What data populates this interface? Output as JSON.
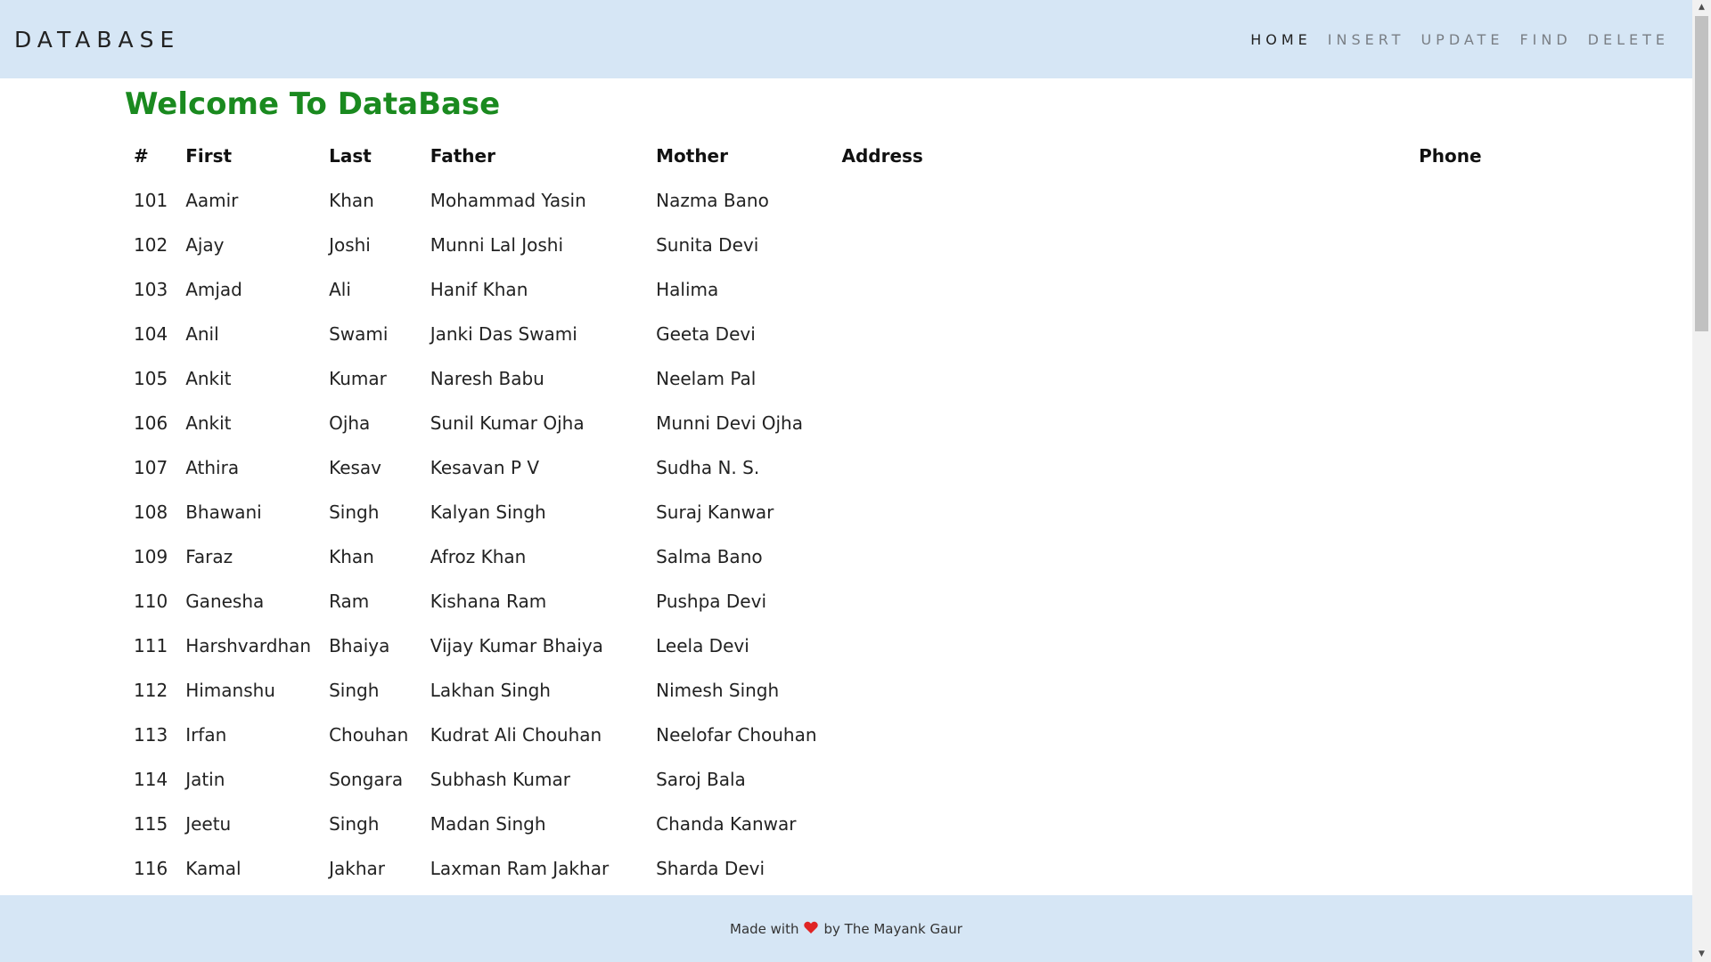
{
  "navbar": {
    "brand": "DATABASE",
    "links": [
      "HOME",
      "INSERT",
      "UPDATE",
      "FIND",
      "DELETE"
    ]
  },
  "page": {
    "heading": "Welcome To DataBase",
    "heading_color": "#1a8a1f"
  },
  "table": {
    "headers": [
      "#",
      "First",
      "Last",
      "Father",
      "Mother",
      "Address",
      "Phone"
    ],
    "rows": [
      [
        "101",
        "Aamir",
        "Khan",
        "Mohammad Yasin",
        "Nazma Bano",
        "",
        ""
      ],
      [
        "102",
        "Ajay",
        "Joshi",
        "Munni Lal Joshi",
        "Sunita Devi",
        "",
        ""
      ],
      [
        "103",
        "Amjad",
        "Ali",
        "Hanif Khan",
        "Halima",
        "",
        ""
      ],
      [
        "104",
        "Anil",
        "Swami",
        "Janki Das Swami",
        "Geeta Devi",
        "",
        ""
      ],
      [
        "105",
        "Ankit",
        "Kumar",
        "Naresh Babu",
        "Neelam Pal",
        "",
        ""
      ],
      [
        "106",
        "Ankit",
        "Ojha",
        "Sunil Kumar Ojha",
        "Munni Devi Ojha",
        "",
        ""
      ],
      [
        "107",
        "Athira",
        "Kesav",
        "Kesavan P V",
        "Sudha N. S.",
        "",
        ""
      ],
      [
        "108",
        "Bhawani",
        "Singh",
        "Kalyan Singh",
        "Suraj Kanwar",
        "",
        ""
      ],
      [
        "109",
        "Faraz",
        "Khan",
        "Afroz Khan",
        "Salma Bano",
        "",
        ""
      ],
      [
        "110",
        "Ganesha",
        "Ram",
        "Kishana Ram",
        "Pushpa Devi",
        "",
        ""
      ],
      [
        "111",
        "Harshvardhan",
        "Bhaiya",
        "Vijay Kumar Bhaiya",
        "Leela Devi",
        "",
        ""
      ],
      [
        "112",
        "Himanshu",
        "Singh",
        "Lakhan Singh",
        "Nimesh Singh",
        "",
        ""
      ],
      [
        "113",
        "Irfan",
        "Chouhan",
        "Kudrat Ali Chouhan",
        "Neelofar Chouhan",
        "",
        ""
      ],
      [
        "114",
        "Jatin",
        "Songara",
        "Subhash Kumar",
        "Saroj Bala",
        "",
        ""
      ],
      [
        "115",
        "Jeetu",
        "Singh",
        "Madan Singh",
        "Chanda Kanwar",
        "",
        ""
      ],
      [
        "116",
        "Kamal",
        "Jakhar",
        "Laxman Ram Jakhar",
        "Sharda Devi",
        "",
        ""
      ]
    ]
  },
  "footer": {
    "prefix": "Made with",
    "heart_icon": "heart-icon",
    "suffix": "by The Mayank Gaur",
    "heart_color": "#e02424"
  },
  "colors": {
    "navbar_bg": "#d6e6f5",
    "footer_bg": "#d6e6f5"
  },
  "scrollbar": {
    "position_fraction": 0.0
  }
}
